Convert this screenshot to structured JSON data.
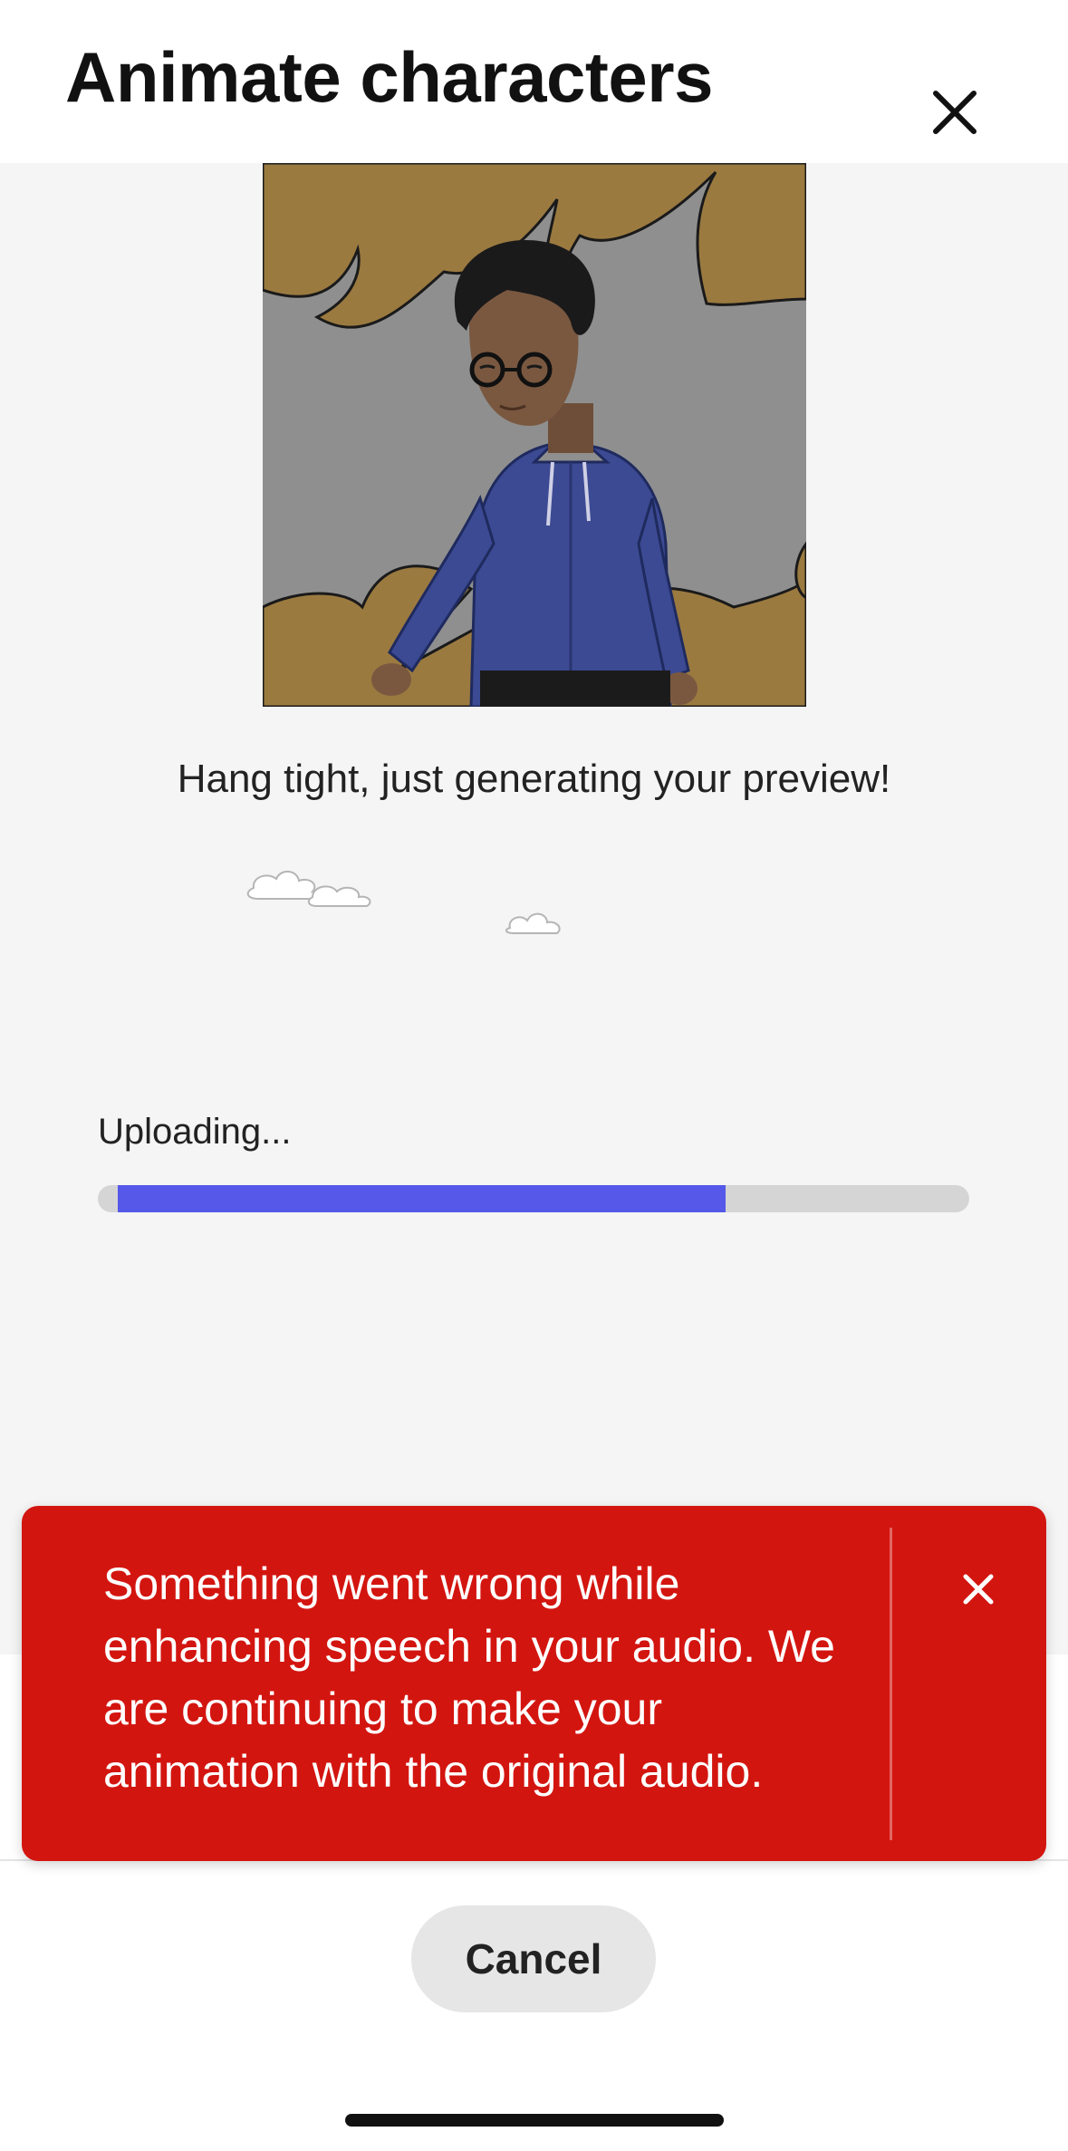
{
  "header": {
    "title": "Animate characters",
    "close_icon": "close-icon"
  },
  "preview": {
    "status_text": "Hang tight, just generating your preview!",
    "colors": {
      "backdrop": "#8f8f8f",
      "burst": "#9b7a40",
      "hoodie": "#3c4a93",
      "skin": "#7a5840"
    }
  },
  "upload": {
    "label": "Uploading...",
    "progress_percent": 72,
    "fill_color": "#5558e8",
    "track_color": "#d5d5d5"
  },
  "toast": {
    "message": "Something went wrong while enhancing speech in your audio. We are continuing to make your animation with the original audio.",
    "close_icon": "close-icon",
    "background_color": "#d31510"
  },
  "footer": {
    "cancel_label": "Cancel"
  }
}
